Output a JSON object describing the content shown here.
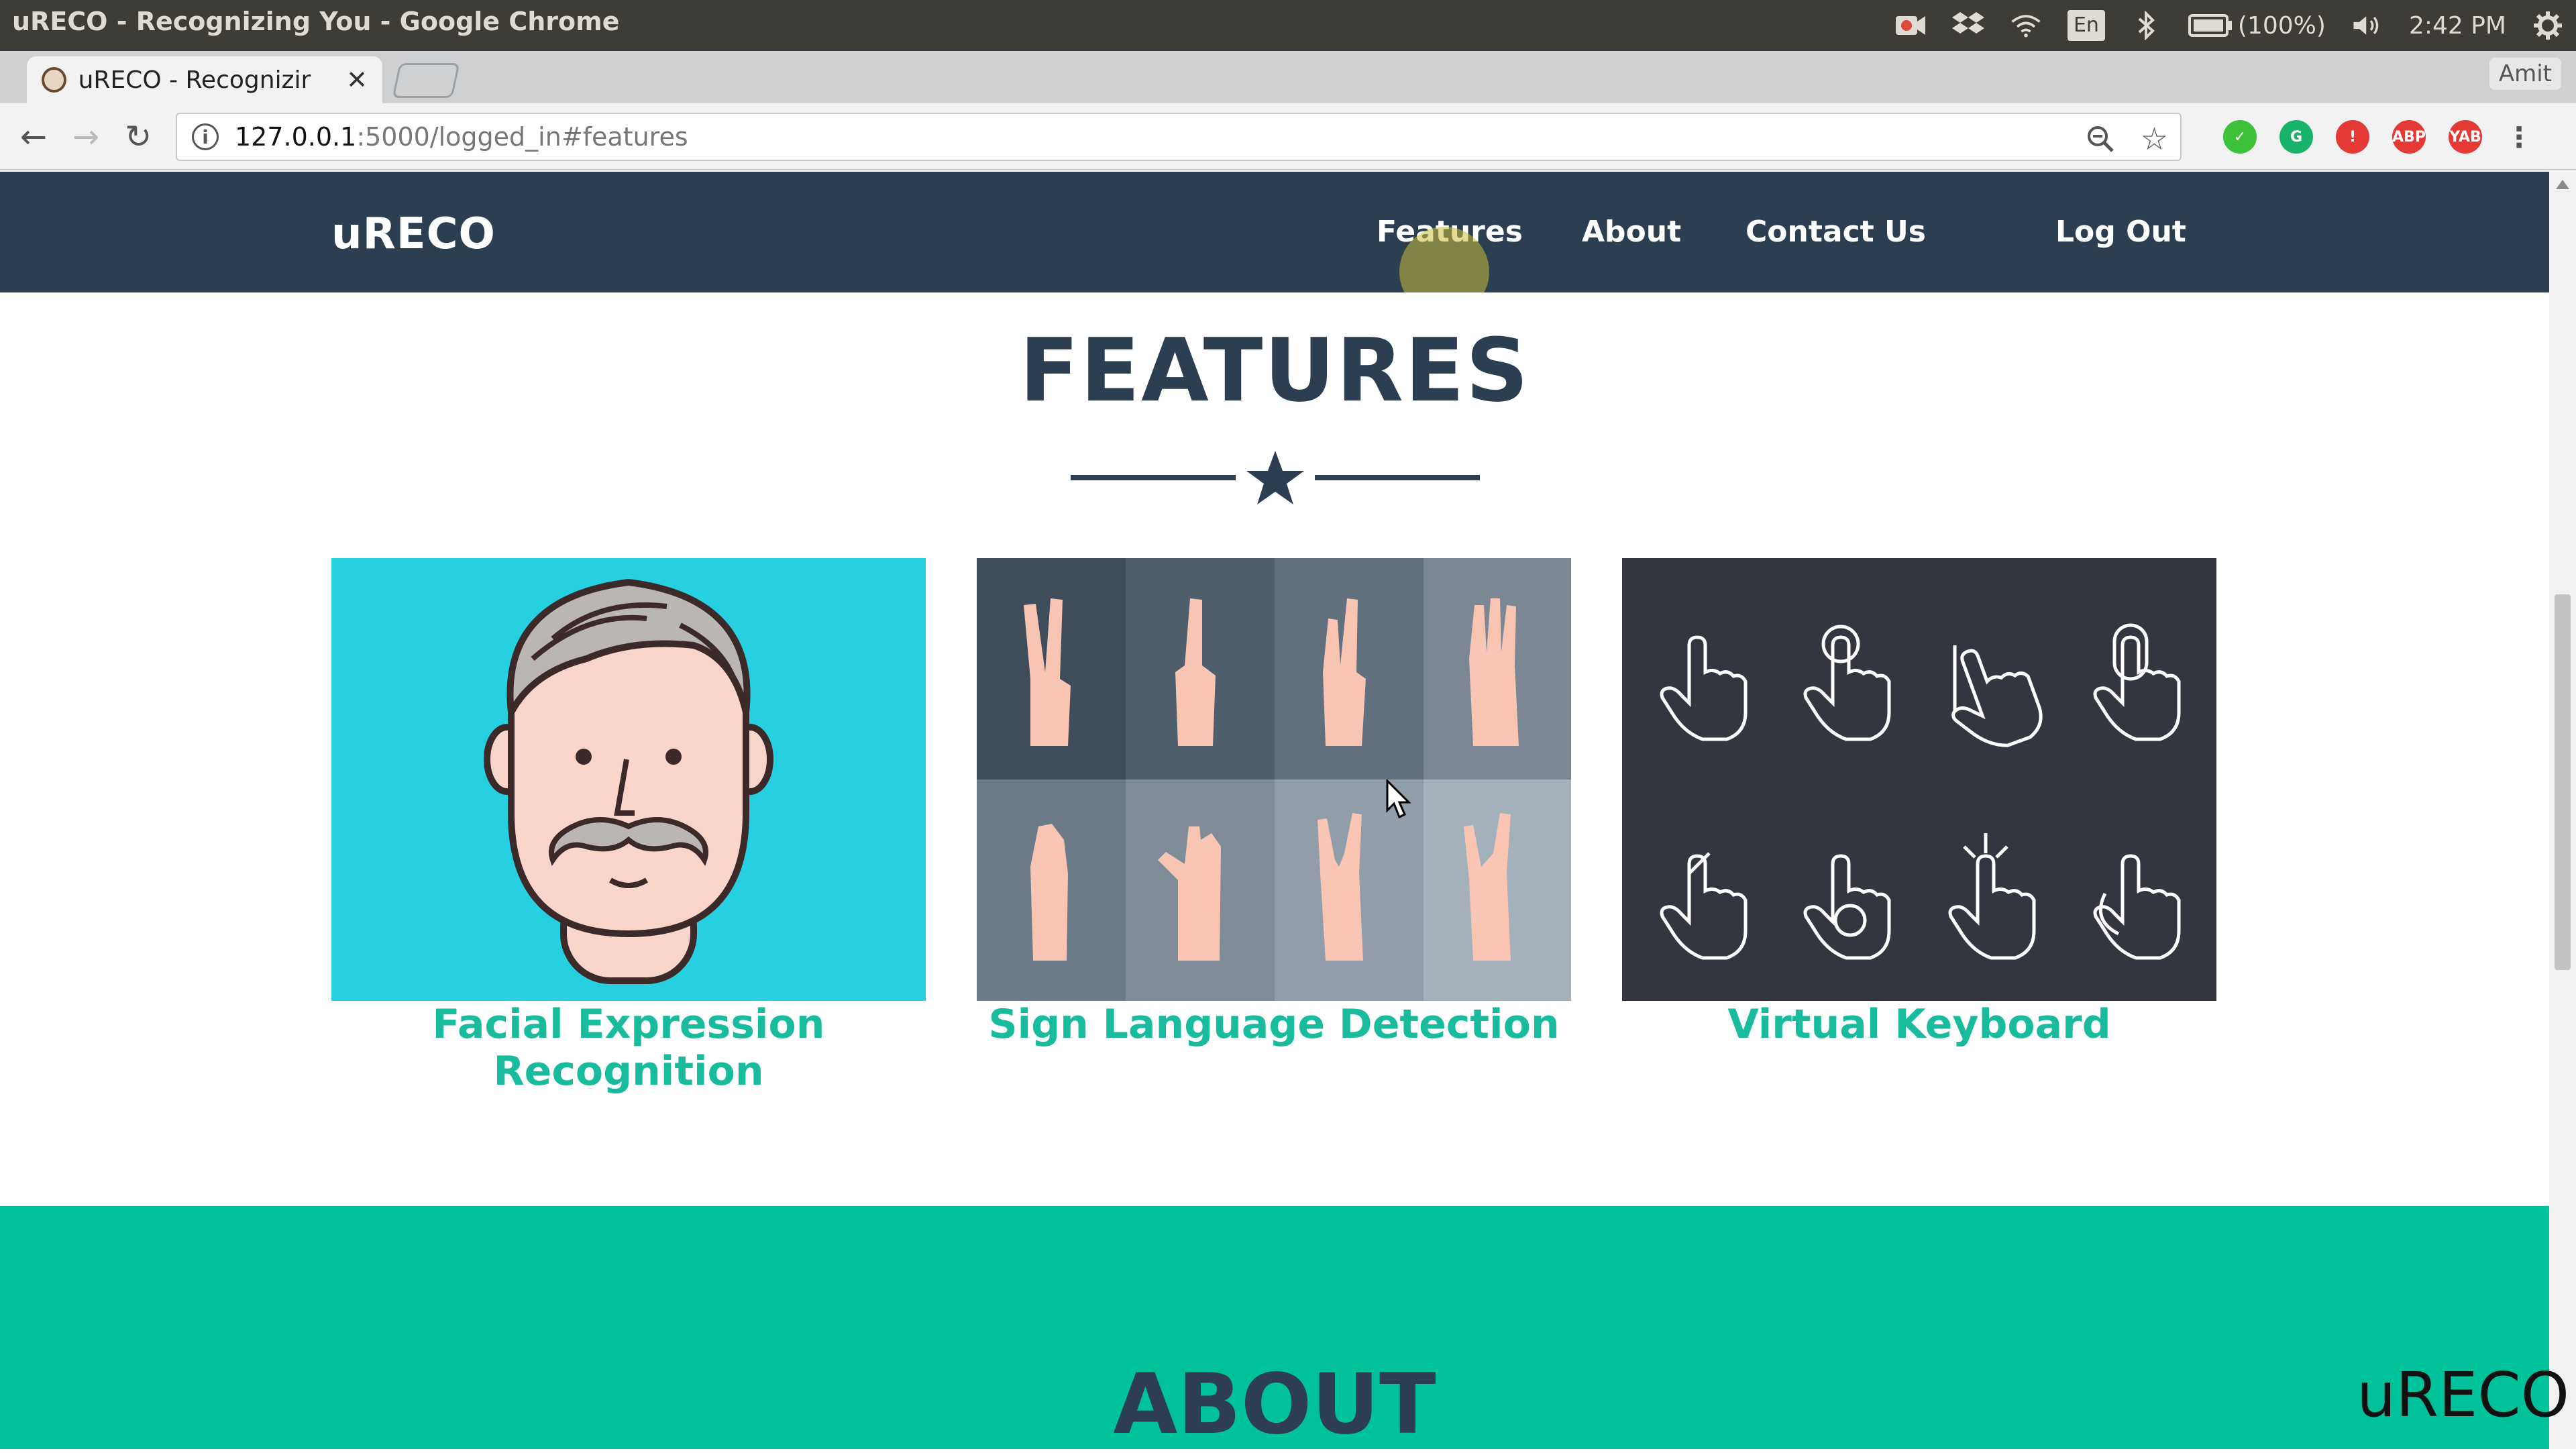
{
  "os": {
    "window_title": "uRECO - Recognizing You - Google Chrome",
    "battery": "(100%)",
    "time": "2:42 PM",
    "keyboard_layout": "En",
    "icons": [
      "record-icon",
      "dropbox-icon",
      "wifi-icon",
      "keyboard-layout-icon",
      "bluetooth-icon",
      "battery-icon",
      "volume-icon",
      "settings-gear-icon"
    ]
  },
  "browser": {
    "tab_title": "uRECO - Recognizir",
    "profile_name": "Amit",
    "url_host": "127.0.0.1",
    "url_rest": ":5000/logged_in#features",
    "extension_colors": [
      "#3cc13b",
      "#19b36b",
      "#e53935",
      "#e53935",
      "#e53935"
    ],
    "extension_labels": [
      "",
      "",
      "",
      "ABP",
      "YAB"
    ]
  },
  "site": {
    "brand": "uRECO",
    "nav": {
      "features": "Features",
      "about": "About",
      "contact": "Contact Us",
      "logout": "Log Out"
    },
    "colors": {
      "navbar": "#2c3e50",
      "accent": "#18bc9c",
      "about_bg": "#00c29a",
      "card1_bg": "#27d0e0",
      "card3_bg": "#34363f"
    }
  },
  "features": {
    "heading": "FEATURES",
    "cards": [
      {
        "title": "Facial Expression Recognition",
        "line1": "Facial Expression",
        "line2": "Recognition",
        "icon": "face-icon"
      },
      {
        "title": "Sign Language Detection",
        "icon": "hand-signs-icon"
      },
      {
        "title": "Virtual Keyboard",
        "icon": "touch-gestures-icon"
      }
    ]
  },
  "about": {
    "heading": "ABOUT"
  },
  "watermark": "uRECO"
}
